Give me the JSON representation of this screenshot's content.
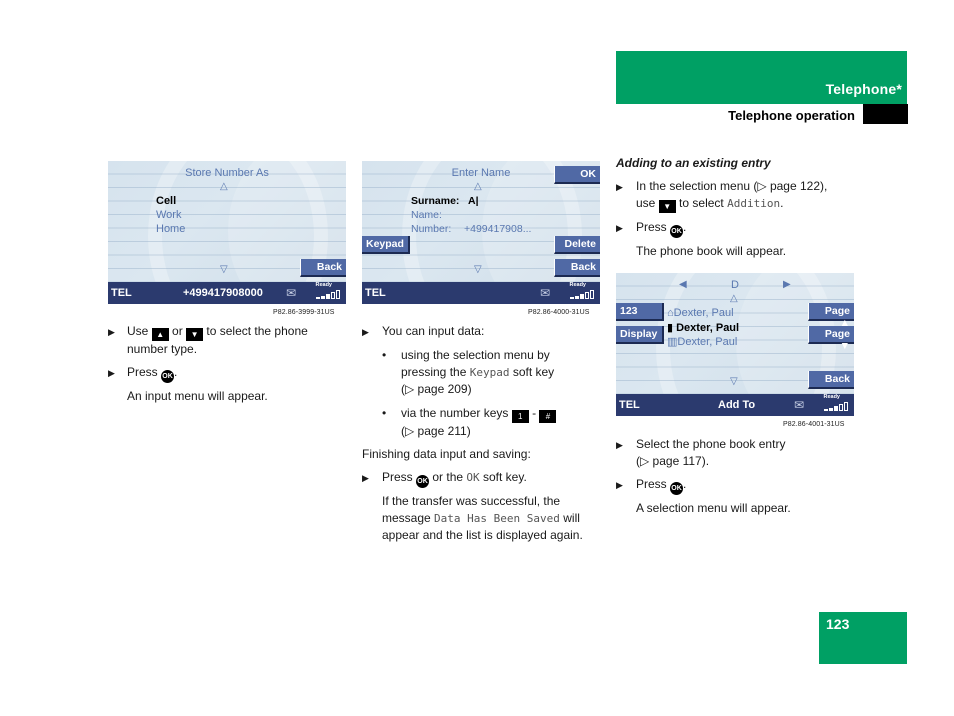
{
  "header": {
    "section": "Telephone*",
    "subsection": "Telephone operation"
  },
  "page_number": "123",
  "screen1": {
    "title": "Store Number As",
    "items": [
      "Cell",
      "Work",
      "Home"
    ],
    "selected_index": 0,
    "softkey_back": "Back",
    "status": {
      "left": "TEL",
      "middle": "+499417908000",
      "ready": "Ready"
    },
    "figure_code": "P82.86-3999-31US"
  },
  "screen2": {
    "title": "Enter Name",
    "fields": [
      {
        "label": "Surname:",
        "value": "A|"
      },
      {
        "label": "Name:",
        "value": ""
      },
      {
        "label": "Number:",
        "value": "+499417908..."
      }
    ],
    "softkey_ok": "OK",
    "softkey_keypad": "Keypad",
    "softkey_delete": "Delete",
    "softkey_back": "Back",
    "status": {
      "left": "TEL",
      "ready": "Ready"
    },
    "figure_code": "P82.86-4000-31US"
  },
  "screen3": {
    "letter": "D",
    "entries": [
      {
        "icon": "home",
        "name": "Dexter, Paul"
      },
      {
        "icon": "mobile",
        "name": "Dexter, Paul"
      },
      {
        "icon": "office",
        "name": "Dexter, Paul"
      }
    ],
    "selected_index": 1,
    "softkey_123": "123",
    "softkey_display": "Display",
    "softkey_page_up": "Page ▲",
    "softkey_page_down": "Page ▼",
    "softkey_back": "Back",
    "status": {
      "left": "TEL",
      "middle": "Add To",
      "ready": "Ready"
    },
    "figure_code": "P82.86-4001-31US"
  },
  "col1": {
    "step1_pre": "Use",
    "step1_or": "or",
    "step1_post": "to select the phone",
    "step1_line2": "number type.",
    "step2_pre": "Press",
    "result": "An input menu will appear."
  },
  "col2": {
    "intro": "You can input data:",
    "sub1_l1": "using the selection menu by",
    "sub1_l2_pre": "pressing the",
    "sub1_l2_code": "Keypad",
    "sub1_l2_post": "soft key",
    "sub1_l3": "(▷ page 209)",
    "sub2_l1": "via the number keys",
    "sub2_key1": "1",
    "sub2_dash": "-",
    "sub2_key2": "#",
    "sub2_l2": "(▷ page 211)",
    "finish": "Finishing data input and saving:",
    "step_pre": "Press",
    "step_mid": "or the",
    "step_code": "OK",
    "step_post": "soft key.",
    "result_l1": "If the transfer was successful, the",
    "result_l2_pre": "message",
    "result_l2_code": "Data Has Been Saved",
    "result_l2_post": "will",
    "result_l3": "appear and the list is displayed again."
  },
  "col3": {
    "heading": "Adding to an existing entry",
    "step1_l1": "In the selection menu (▷ page 122),",
    "step1_l2_pre": "use",
    "step1_l2_post": "to select",
    "step1_code": "Addition",
    "step2_pre": "Press",
    "result1": "The phone book will appear.",
    "step3_l1": "Select the phone book entry",
    "step3_l2": "(▷ page 117).",
    "step4_pre": "Press",
    "result2": "A selection menu will appear."
  },
  "keys": {
    "ok": "OK",
    "up": "▲",
    "down": "▼"
  }
}
